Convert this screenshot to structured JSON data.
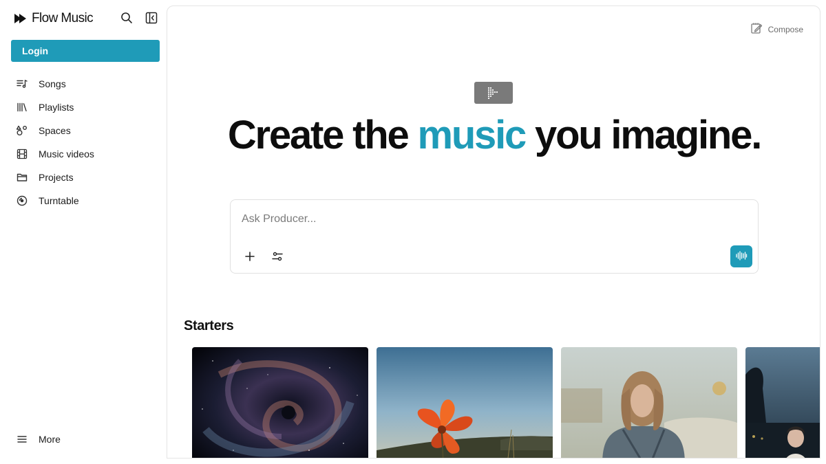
{
  "brand": {
    "name": "Flow Music",
    "logo_icon": "play-forward-icon"
  },
  "sidebar": {
    "login_label": "Login",
    "items": [
      {
        "label": "Songs",
        "icon": "songs-icon"
      },
      {
        "label": "Playlists",
        "icon": "library-icon"
      },
      {
        "label": "Spaces",
        "icon": "shapes-icon"
      },
      {
        "label": "Music videos",
        "icon": "film-icon"
      },
      {
        "label": "Projects",
        "icon": "folder-icon"
      },
      {
        "label": "Turntable",
        "icon": "disc-icon"
      }
    ],
    "more_label": "More"
  },
  "main": {
    "compose_label": "Compose",
    "hero": {
      "title_before": "Create the ",
      "title_accent": "music",
      "title_after": " you imagine."
    },
    "prompt": {
      "placeholder": "Ask Producer...",
      "value": ""
    },
    "starters": {
      "title": "Starters",
      "cards": [
        {
          "image": "cosmic-swirl"
        },
        {
          "image": "orange-flower-sky"
        },
        {
          "image": "woman-with-car"
        },
        {
          "image": "person-dusk"
        }
      ]
    }
  },
  "colors": {
    "accent": "#1f9bb8",
    "text": "#0d0d0d",
    "muted": "#6b6b6b",
    "border": "#e4e4e4"
  }
}
